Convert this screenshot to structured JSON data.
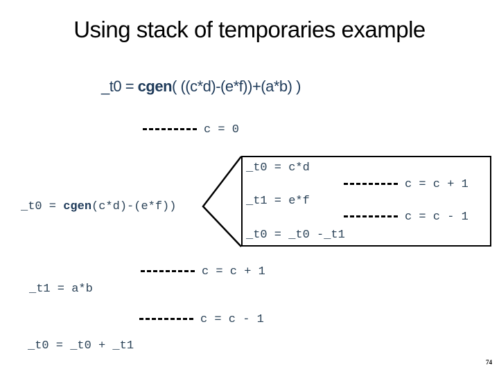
{
  "slide": {
    "title": "Using stack of temporaries example",
    "expression": {
      "lhs": "_t0 = ",
      "fn": "cgen",
      "args": "( ((c*d)-(e*f))+(a*b) )"
    },
    "top_annotation": "c = 0",
    "left_call": {
      "lhs": "_t0 = ",
      "fn": "cgen",
      "args": "(c*d)-(e*f))"
    },
    "box_lines": [
      "_t0 = c*d",
      "_t1 = e*f",
      "_t0 = _t0 -_t1"
    ],
    "box_annotations": [
      "c = c + 1",
      "c = c - 1"
    ],
    "lower_lines": [
      "_t1 = a*b",
      "_t0 = _t0 + _t1"
    ],
    "lower_annotations": [
      "c = c + 1",
      "c = c - 1"
    ],
    "page_number": "74"
  }
}
